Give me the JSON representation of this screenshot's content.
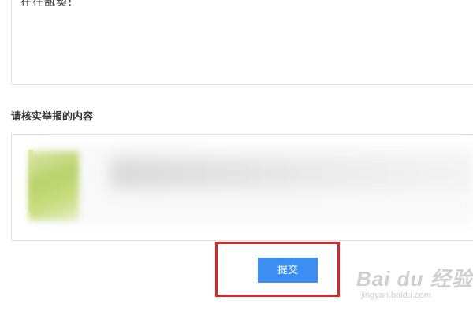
{
  "reason": {
    "text": "在在瓿契!"
  },
  "verify_section": {
    "title": "请核实举报的内容"
  },
  "form": {
    "submit_label": "提交"
  },
  "watermark": {
    "logo": "Bai du 经验",
    "url": "jingyan.baidu.com"
  },
  "colors": {
    "submit_bg": "#3d8ef3",
    "highlight_border": "#d9282a"
  }
}
